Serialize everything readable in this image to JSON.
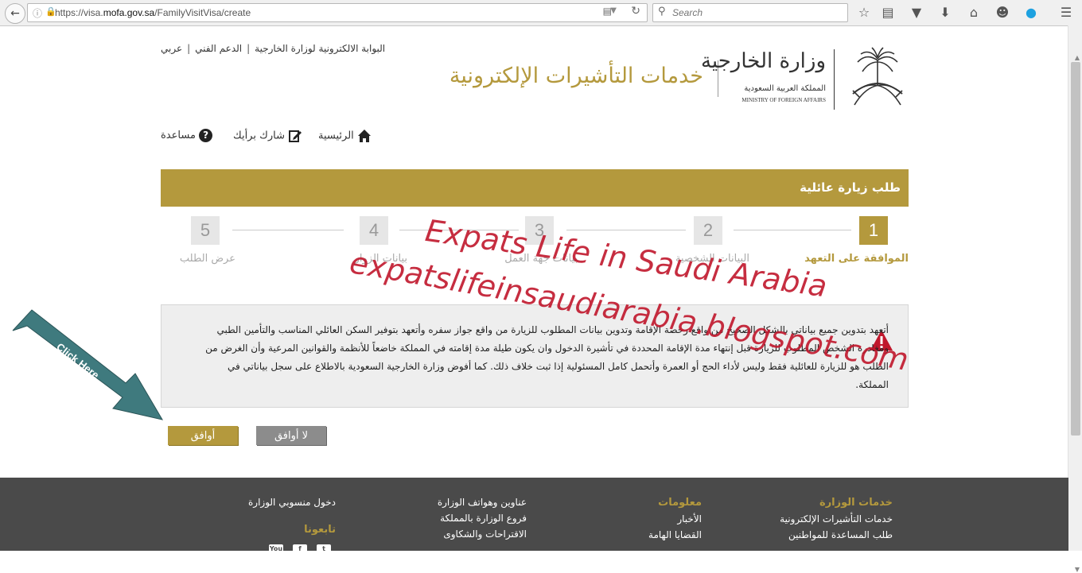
{
  "browser": {
    "url_prefix": "https://visa.",
    "url_domain": "mofa.gov.sa",
    "url_path": "/FamilyVisitVisa/create",
    "search_placeholder": "Search"
  },
  "header": {
    "lang_link": "عربي",
    "support_link": "الدعم الفني",
    "portal_link": "البوابة الالكترونية لوزارة الخارجية",
    "site_title": "خدمات التأشيرات الإلكترونية",
    "logo_ar_title": "وزارة الخارجية",
    "logo_ar_sub": "المملكة العربية السعودية",
    "logo_en": "MINISTRY OF FOREIGN AFFAIRS"
  },
  "nav": {
    "home": "الرئيسية",
    "feedback": "شارك برأيك",
    "help": "مساعدة",
    "help_glyph": "?"
  },
  "form": {
    "title": "طلب زيارة عائلية",
    "steps": [
      {
        "num": "1",
        "label": "الموافقة على التعهد"
      },
      {
        "num": "2",
        "label": "البيانات الشخصية"
      },
      {
        "num": "3",
        "label": "بيانات جهة العمل"
      },
      {
        "num": "4",
        "label": "بيانات الزوار"
      },
      {
        "num": "5",
        "label": "عرض الطلب"
      }
    ],
    "pledge_text": "أتعهد بتدوين جميع بياناتي بالشكل الصحيح من واقع رخصة الإقامة وتدوين بيانات المطلوب للزيارة من واقع جواز سفره وأتعهد بتوفير السكن العائلي المناسب والتأمين الطبي ومغادرة الشخص المطلوب للزيارة قبل إنتهاء مدة الإقامة المحددة في تأشيرة الدخول وان يكون طيلة مدة إقامته في المملكة خاضعاً للأنظمة والقوانين المرعية وأن الغرض من الطلب هو للزيارة للعائلية فقط وليس لأداء الحج أو العمرة وأتحمل كامل المسئولية إذا ثبت خلاف ذلك. كما أفوض وزارة الخارجية السعودية بالاطلاع على سجل بياناتي في المملكة.",
    "agree_label": "أوافق",
    "disagree_label": "لا أوافق"
  },
  "footer": {
    "col1_head": "خدمات الوزارة",
    "col1_links": [
      "خدمات التأشيرات الإلكترونية",
      "طلب المساعدة للمواطنين"
    ],
    "col2_head": "معلومات",
    "col2_links": [
      "الأخبار",
      "القضايا الهامة"
    ],
    "col3_links": [
      "عناوين وهواتف الوزارة",
      "فروع الوزارة بالمملكة",
      "الاقتراحات والشكاوى"
    ],
    "col4_links": [
      "دخول منسوبي الوزارة"
    ],
    "follow_head": "تابعونا",
    "social": [
      "You",
      "f",
      "t"
    ]
  },
  "overlay": {
    "watermark_line1": "Expats Life in Saudi Arabia",
    "watermark_line2": "expatslifeinsaudiarabia.blogspot.com",
    "arrow_label": "Click Here"
  },
  "colors": {
    "gold": "#b4993d",
    "footer_bg": "#4a4a4a",
    "watermark": "#c0172c",
    "arrow": "#3f7a7e"
  }
}
